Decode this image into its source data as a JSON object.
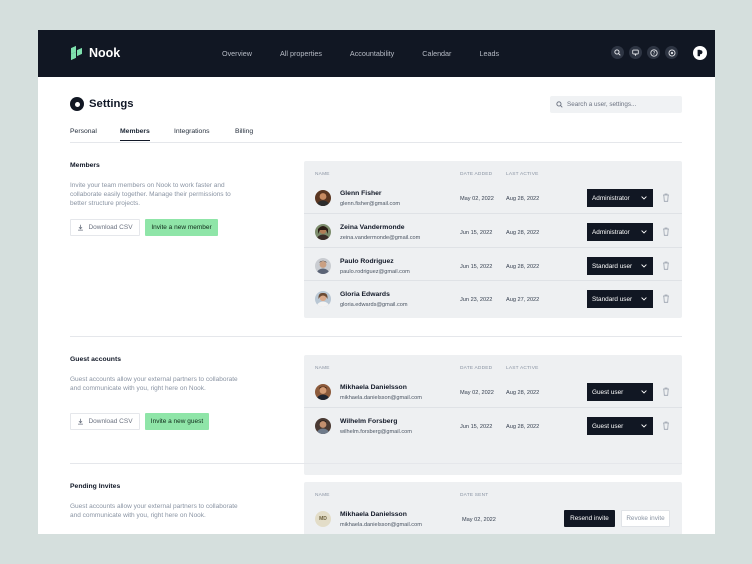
{
  "app": {
    "name": "Nook"
  },
  "nav": {
    "links": [
      "Overview",
      "All properties",
      "Accountability",
      "Calendar",
      "Leads"
    ],
    "icons": [
      "search-icon",
      "chat-icon",
      "help-icon",
      "settings-icon"
    ]
  },
  "page": {
    "title": "Settings"
  },
  "search": {
    "placeholder": "Search a user, settings..."
  },
  "tabs": [
    "Personal",
    "Members",
    "Integrations",
    "Billing"
  ],
  "members": {
    "title": "Members",
    "description": "Invite your team members on Nook to work faster and collaborate easily together. Manage their permissions to better structure projects.",
    "download_label": "Download CSV",
    "invite_label": "Invite a new member",
    "columns": {
      "name": "NAME",
      "date_added": "DATE ADDED",
      "last_active": "LAST ACTIVE"
    },
    "rows": [
      {
        "name": "Glenn Fisher",
        "email": "glenn.fisher@gmail.com",
        "date_added": "May 02, 2022",
        "last_active": "Aug 28, 2022",
        "role": "Administrator"
      },
      {
        "name": "Zeina Vandermonde",
        "email": "zeina.vandermonde@gmail.com",
        "date_added": "Jun 15, 2022",
        "last_active": "Aug 28, 2022",
        "role": "Administrator"
      },
      {
        "name": "Paulo Rodriguez",
        "email": "paulo.rodriguez@gmail.com",
        "date_added": "Jun 15, 2022",
        "last_active": "Aug 28, 2022",
        "role": "Standard user"
      },
      {
        "name": "Gloria Edwards",
        "email": "gloria.edwards@gmail.com",
        "date_added": "Jun 23, 2022",
        "last_active": "Aug 27, 2022",
        "role": "Standard user"
      }
    ]
  },
  "guests": {
    "title": "Guest accounts",
    "description": "Guest accounts allow your external partners to collaborate and communicate with you, right here on Nook.",
    "download_label": "Download CSV",
    "invite_label": "Invite a new guest",
    "columns": {
      "name": "NAME",
      "date_added": "DATE ADDED",
      "last_active": "LAST ACTIVE"
    },
    "rows": [
      {
        "name": "Mikhaela Danielsson",
        "email": "mikhaela.danielsson@gmail.com",
        "date_added": "May 02, 2022",
        "last_active": "Aug 28, 2022",
        "role": "Guest user"
      },
      {
        "name": "Wilhelm Forsberg",
        "email": "wilhelm.forsberg@gmail.com",
        "date_added": "Jun 15, 2022",
        "last_active": "Aug 28, 2022",
        "role": "Guest user"
      }
    ]
  },
  "pending": {
    "title": "Pending Invites",
    "description": "Guest accounts allow your external partners to collaborate and communicate with you, right here on Nook.",
    "columns": {
      "name": "NAME",
      "date_sent": "DATE SENT"
    },
    "rows": [
      {
        "initials": "MD",
        "name": "Mikhaela Danielsson",
        "email": "mikhaela.danielsson@gmail.com",
        "date_sent": "May 02, 2022",
        "resend_label": "Resend invite",
        "revoke_label": "Revoke invite"
      }
    ]
  },
  "colors": {
    "nav_bg": "#111723",
    "accent_green": "#8fe5a8",
    "card_bg": "#eef0f2",
    "page_bg": "#d5dfdd"
  }
}
